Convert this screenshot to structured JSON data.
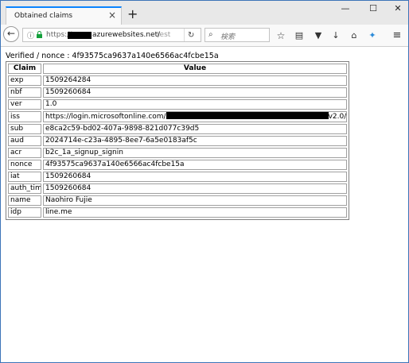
{
  "browser": {
    "tab_title": "Obtained claims",
    "tab_close": "×",
    "new_tab": "+",
    "url_scheme": "https://",
    "url_host": "azurewebsites.net/",
    "url_path_fragment": "test",
    "search_placeholder": "検索"
  },
  "page": {
    "verified_text": "Verified / nonce : 4f93575ca9637a140e6566ac4fcbe15a",
    "columns": [
      "Claim",
      "Value"
    ],
    "rows": [
      {
        "claim": "exp",
        "value": "1509264284"
      },
      {
        "claim": "nbf",
        "value": "1509260684"
      },
      {
        "claim": "ver",
        "value": "1.0"
      },
      {
        "claim": "iss",
        "value_prefix": "https://login.microsoftonline.com/",
        "value_suffix": "v2.0/"
      },
      {
        "claim": "sub",
        "value": "e8ca2c59-bd02-407a-9898-821d077c39d5"
      },
      {
        "claim": "aud",
        "value": "2024714e-c23a-4895-8ee7-6a5e0183af5c"
      },
      {
        "claim": "acr",
        "value": "b2c_1a_signup_signin"
      },
      {
        "claim": "nonce",
        "value": "4f93575ca9637a140e6566ac4fcbe15a"
      },
      {
        "claim": "iat",
        "value": "1509260684"
      },
      {
        "claim": "auth_time",
        "value": "1509260684"
      },
      {
        "claim": "name",
        "value": "Naohiro Fujie"
      },
      {
        "claim": "idp",
        "value": "line.me"
      }
    ]
  },
  "colors": {
    "window_border": "#3c74b8",
    "tab_accent": "#0a84ff",
    "lock_green": "#14a03c"
  }
}
